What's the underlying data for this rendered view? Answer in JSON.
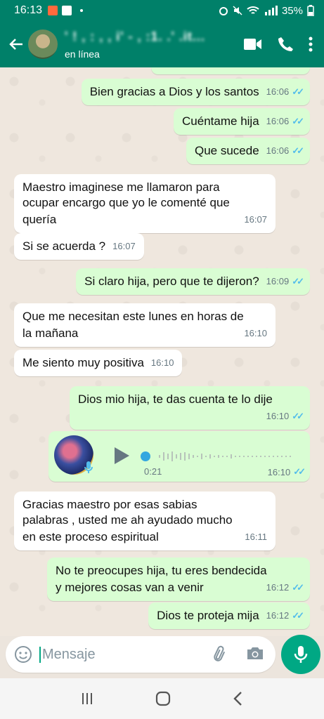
{
  "status_bar": {
    "time": "16:13",
    "battery": "35%"
  },
  "header": {
    "contact_name": "' ! , : , , i' - , :1. .' .it...",
    "status": "en línea"
  },
  "messages": {
    "m1": {
      "text": "Bien gracias a Dios y los santos",
      "time": "16:06"
    },
    "m2": {
      "text": "Cuéntame hija",
      "time": "16:06"
    },
    "m3": {
      "text": "Que sucede",
      "time": "16:06"
    },
    "m4": {
      "line1": "Maestro imaginese me llamaron para",
      "line2": "ocupar encargo que yo le comenté que",
      "line3": "quería",
      "time": "16:07"
    },
    "m5": {
      "text": "Si se acuerda ?",
      "time": "16:07"
    },
    "m6": {
      "text": "Si claro hija,  pero que te dijeron?",
      "time": "16:09"
    },
    "m7": {
      "line1": "Que me necesitan este lunes en horas de",
      "line2": "la mañana",
      "time": "16:10"
    },
    "m8": {
      "text": "Me siento muy positiva",
      "time": "16:10"
    },
    "m9": {
      "text": "Dios mio hija,  te das  cuenta te lo dije",
      "time": "16:10"
    },
    "voice": {
      "duration": "0:21",
      "time": "16:10"
    },
    "m10": {
      "line1": "Gracias maestro por esas sabias",
      "line2": "palabras , usted me ah ayudado mucho",
      "line3": "en este proceso espiritual",
      "time": "16:11"
    },
    "m11": {
      "line1": "No te preocupes hija, tu eres bendecida",
      "line2": "y mejores cosas van a venir",
      "time": "16:12"
    },
    "m12": {
      "text": "Dios te proteja mija",
      "time": "16:12"
    }
  },
  "composer": {
    "placeholder": "Mensaje"
  },
  "colors": {
    "header": "#008069",
    "outgoing": "#d9fdd3",
    "incoming": "#ffffff",
    "read_ticks": "#53bdeb",
    "accent": "#00a884"
  }
}
